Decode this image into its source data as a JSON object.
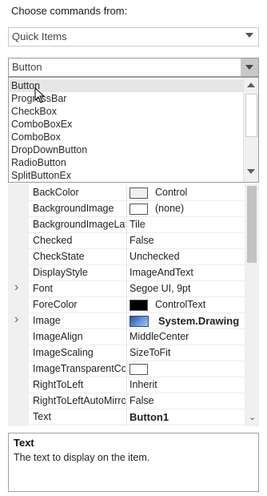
{
  "header": {
    "label": "Choose commands from:"
  },
  "source_combo": {
    "value": "Quick Items"
  },
  "type_combo": {
    "value": "Button"
  },
  "dropdown": {
    "items": [
      "Button",
      "ProgressBar",
      "CheckBox",
      "ComboBoxEx",
      "ComboBox",
      "DropDownButton",
      "RadioButton",
      "SplitButtonEx"
    ],
    "highlighted_index": 0
  },
  "properties": [
    {
      "name": "BackColor",
      "value": "Control",
      "swatch": "#f0f0f0"
    },
    {
      "name": "BackgroundImage",
      "value": "(none)",
      "swatch": "#ffffff"
    },
    {
      "name": "BackgroundImageLayout",
      "value": "Tile"
    },
    {
      "name": "Checked",
      "value": "False"
    },
    {
      "name": "CheckState",
      "value": "Unchecked"
    },
    {
      "name": "DisplayStyle",
      "value": "ImageAndText"
    },
    {
      "name": "Font",
      "value": "Segoe UI, 9pt",
      "expandable": true
    },
    {
      "name": "ForeColor",
      "value": "ControlText",
      "swatch": "#000000"
    },
    {
      "name": "Image",
      "value": "System.Drawing",
      "expandable": true,
      "image": true,
      "bold": true
    },
    {
      "name": "ImageAlign",
      "value": "MiddleCenter"
    },
    {
      "name": "ImageScaling",
      "value": "SizeToFit"
    },
    {
      "name": "ImageTransparentColor",
      "value": "",
      "swatch": "#ffffff"
    },
    {
      "name": "RightToLeft",
      "value": "Inherit"
    },
    {
      "name": "RightToLeftAutoMirrorImage",
      "value": "False"
    },
    {
      "name": "Text",
      "value": "Button1",
      "bold": true
    }
  ],
  "description": {
    "title": "Text",
    "text": "The text to display on the item."
  },
  "icons": {
    "combo_arrow": "chevron-down-icon",
    "expander": "chevron-right-icon",
    "scroll_up": "arrow-up-icon",
    "scroll_down": "arrow-down-icon"
  }
}
